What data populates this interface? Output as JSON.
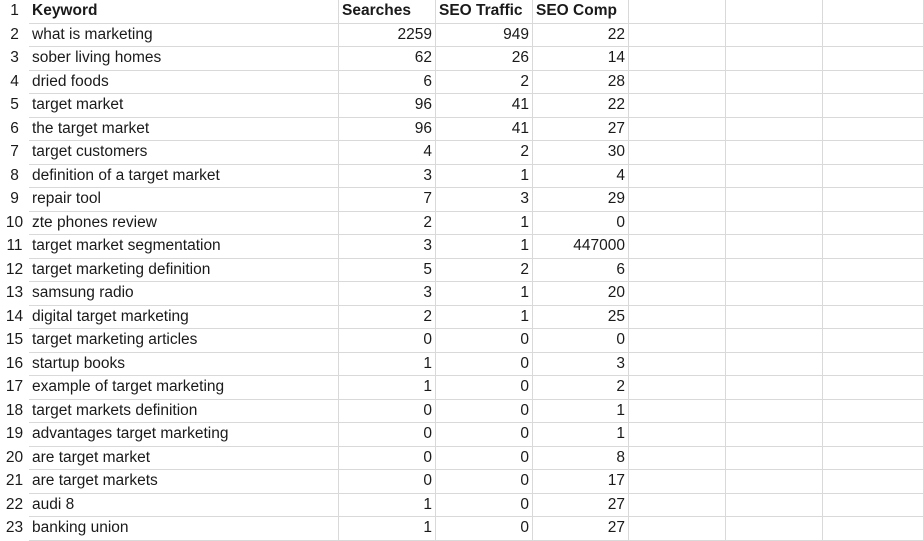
{
  "sheet": {
    "headers": [
      "Keyword",
      "Searches",
      "SEO Traffic",
      "SEO Comp"
    ],
    "rows": [
      {
        "row": "1"
      },
      {
        "row": "2",
        "keyword": "what is marketing",
        "searches": "2259",
        "traffic": "949",
        "comp": "22"
      },
      {
        "row": "3",
        "keyword": "sober living homes",
        "searches": "62",
        "traffic": "26",
        "comp": "14"
      },
      {
        "row": "4",
        "keyword": "dried foods",
        "searches": "6",
        "traffic": "2",
        "comp": "28"
      },
      {
        "row": "5",
        "keyword": "target market",
        "searches": "96",
        "traffic": "41",
        "comp": "22"
      },
      {
        "row": "6",
        "keyword": "the target market",
        "searches": "96",
        "traffic": "41",
        "comp": "27"
      },
      {
        "row": "7",
        "keyword": "target customers",
        "searches": "4",
        "traffic": "2",
        "comp": "30"
      },
      {
        "row": "8",
        "keyword": "definition of a target market",
        "searches": "3",
        "traffic": "1",
        "comp": "4"
      },
      {
        "row": "9",
        "keyword": "repair tool",
        "searches": "7",
        "traffic": "3",
        "comp": "29"
      },
      {
        "row": "10",
        "keyword": "zte phones review",
        "searches": "2",
        "traffic": "1",
        "comp": "0"
      },
      {
        "row": "11",
        "keyword": "target market segmentation",
        "searches": "3",
        "traffic": "1",
        "comp": "447000"
      },
      {
        "row": "12",
        "keyword": "target marketing definition",
        "searches": "5",
        "traffic": "2",
        "comp": "6"
      },
      {
        "row": "13",
        "keyword": "samsung radio",
        "searches": "3",
        "traffic": "1",
        "comp": "20"
      },
      {
        "row": "14",
        "keyword": "digital target marketing",
        "searches": "2",
        "traffic": "1",
        "comp": "25"
      },
      {
        "row": "15",
        "keyword": "target marketing articles",
        "searches": "0",
        "traffic": "0",
        "comp": "0"
      },
      {
        "row": "16",
        "keyword": "startup books",
        "searches": "1",
        "traffic": "0",
        "comp": "3"
      },
      {
        "row": "17",
        "keyword": "example of target marketing",
        "searches": "1",
        "traffic": "0",
        "comp": "2"
      },
      {
        "row": "18",
        "keyword": "target markets definition",
        "searches": "0",
        "traffic": "0",
        "comp": "1"
      },
      {
        "row": "19",
        "keyword": "advantages target marketing",
        "searches": "0",
        "traffic": "0",
        "comp": "1"
      },
      {
        "row": "20",
        "keyword": "are target market",
        "searches": "0",
        "traffic": "0",
        "comp": "8"
      },
      {
        "row": "21",
        "keyword": "are target markets",
        "searches": "0",
        "traffic": "0",
        "comp": "17"
      },
      {
        "row": "22",
        "keyword": "audi 8",
        "searches": "1",
        "traffic": "0",
        "comp": "27"
      },
      {
        "row": "23",
        "keyword": "banking union",
        "searches": "1",
        "traffic": "0",
        "comp": "27"
      }
    ]
  }
}
